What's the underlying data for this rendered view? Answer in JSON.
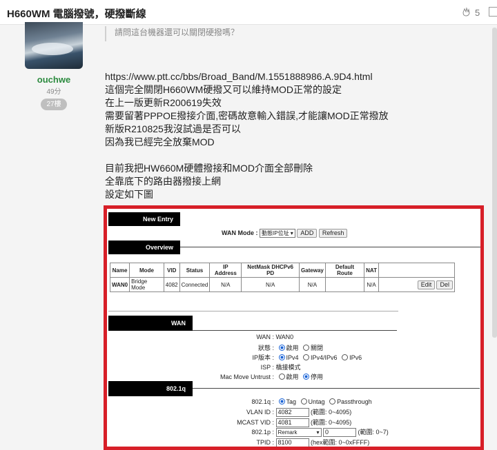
{
  "topbar": {
    "title": "H660WM 電腦撥號，硬撥斷線",
    "clap_count": "5"
  },
  "author": {
    "name": "ouchwe",
    "time": "49分",
    "floor": "27樓"
  },
  "quote": "請問這台機器還可以關閉硬撥嗎？",
  "body_lines": [
    "https://www.ptt.cc/bbs/Broad_Band/M.1551888986.A.9D4.html",
    "這個完全關閉H660WM硬撥又可以維持MOD正常的設定",
    "在上一版更新R200619失效",
    "需要留著PPPOE撥接介面,密碼故意輸入錯誤,才能讓MOD正常撥放",
    "新版R210825我沒試過是否可以",
    "因為我已經完全放棄MOD",
    "",
    "目前我把HW660M硬體撥接和MOD介面全部刪除",
    "全靠底下的路由器撥接上網",
    "設定如下圖"
  ],
  "router": {
    "new_entry": "New Entry",
    "overview": "Overview",
    "wan_mode_label": "WAN Mode :",
    "wan_mode_value": "動態IP位址",
    "add": "ADD",
    "refresh": "Refresh",
    "table_headers": [
      "Name",
      "Mode",
      "VID",
      "Status",
      "IP Address",
      "NetMask DHCPv6 PD",
      "Gateway",
      "Default Route",
      "NAT",
      ""
    ],
    "table_row": [
      "WAN0",
      "Bridge Mode",
      "4082",
      "Connected",
      "N/A",
      "N/A",
      "N/A",
      "",
      "N/A",
      ""
    ],
    "edit": "Edit",
    "del": "Del",
    "wan_section": "WAN",
    "wan_label": "WAN :",
    "wan_value": "WAN0",
    "status_label": "狀態 :",
    "status_on": "啟用",
    "status_off": "關閉",
    "ipver_label": "IP版本 :",
    "ipv4": "IPv4",
    "ipv4v6": "IPv4/IPv6",
    "ipv6": "IPv6",
    "isp_label": "ISP :",
    "isp_value": "橋接模式",
    "mac_label": "Mac Move Untrust :",
    "mac_on": "啟用",
    "mac_off": "停用",
    "q_section": "802.1q",
    "q_label": "802.1q :",
    "q_tag": "Tag",
    "q_untag": "Untag",
    "q_pass": "Passthrough",
    "vlan_label": "VLAN ID :",
    "vlan_value": "4082",
    "vlan_range": "(範圍: 0~4095)",
    "mcast_label": "MCAST VID :",
    "mcast_value": "4081",
    "mcast_range": "(範圍: 0~4095)",
    "p_label": "802.1p :",
    "p_select": "Remark",
    "p_value": "0",
    "p_range": "(範圍: 0~7)",
    "tpid_label": "TPID :",
    "tpid_value": "8100",
    "tpid_range": "(hex範圍: 0~0xFFFF)"
  }
}
